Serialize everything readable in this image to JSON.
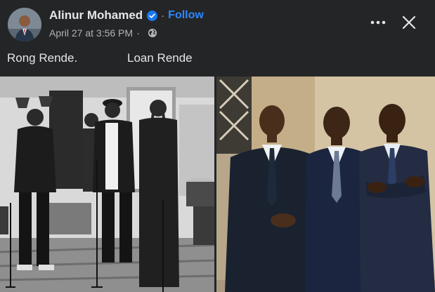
{
  "post": {
    "author": "Alinur Mohamed",
    "separator": "·",
    "follow_label": "Follow",
    "timestamp": "April 27 at 3:56 PM",
    "timestamp_dot": "·",
    "privacy_icon": "globe-icon",
    "more_icon": "more-options-icon",
    "close_icon": "close-icon",
    "caption_part1": "Rong Rende.",
    "caption_part2": "Loan Rende"
  },
  "colors": {
    "background": "#242526",
    "text_primary": "#e4e6eb",
    "text_secondary": "#b0b3b8",
    "link_blue": "#2d88ff",
    "verified_blue": "#1877f2"
  },
  "photos": [
    {
      "name": "band-photo",
      "style": "black-and-white"
    },
    {
      "name": "politicians-photo",
      "style": "color"
    }
  ]
}
